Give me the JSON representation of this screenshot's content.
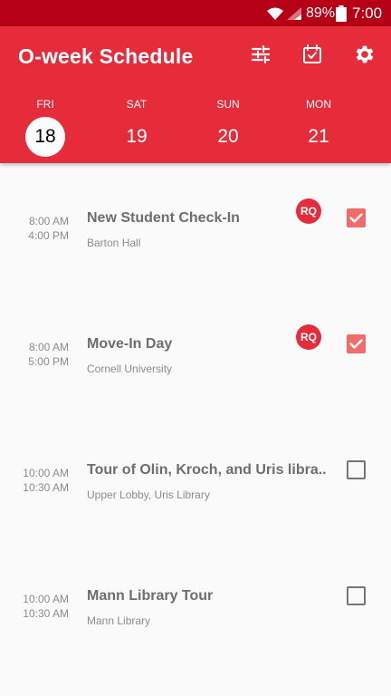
{
  "status_bar": {
    "battery_percent": "89%",
    "time": "7:00"
  },
  "header": {
    "title": "O-week Schedule"
  },
  "days": [
    {
      "dow": "FRI",
      "num": "18",
      "selected": true
    },
    {
      "dow": "SAT",
      "num": "19",
      "selected": false
    },
    {
      "dow": "SUN",
      "num": "20",
      "selected": false
    },
    {
      "dow": "MON",
      "num": "21",
      "selected": false
    }
  ],
  "events": [
    {
      "start": "8:00 AM",
      "end": "4:00 PM",
      "title": "New Student Check-In",
      "location": "Barton Hall",
      "badge": "RQ",
      "checked": true
    },
    {
      "start": "8:00 AM",
      "end": "5:00 PM",
      "title": "Move-In Day",
      "location": "Cornell University",
      "badge": "RQ",
      "checked": true
    },
    {
      "start": "10:00 AM",
      "end": "10:30 AM",
      "title": "Tour of Olin, Kroch, and Uris libra..",
      "location": "Upper Lobby, Uris Library",
      "badge": "",
      "checked": false
    },
    {
      "start": "10:00 AM",
      "end": "10:30 AM",
      "title": "Mann Library Tour",
      "location": "Mann Library",
      "badge": "",
      "checked": false
    }
  ],
  "colors": {
    "brand": "#e62b3b",
    "status_bar": "#b50015",
    "check_on": "#f26b6b"
  }
}
